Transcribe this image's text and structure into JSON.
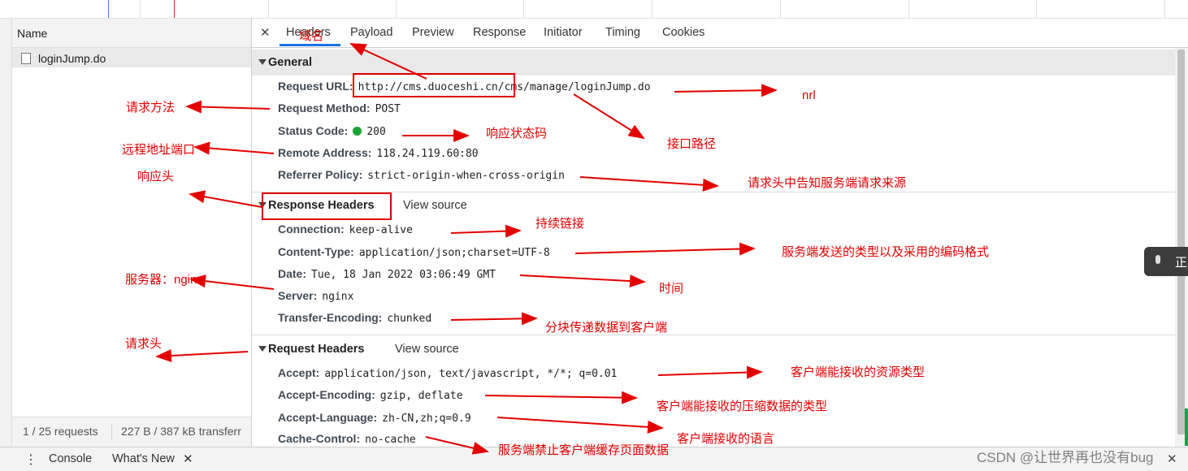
{
  "timeline": {},
  "name_panel": {
    "header": "Name",
    "file": "loginJump.do",
    "footer_requests": "1 / 25 requests",
    "footer_transfer": "227 B / 387 kB transferr"
  },
  "tabs": [
    "Headers",
    "Payload",
    "Preview",
    "Response",
    "Initiator",
    "Timing",
    "Cookies"
  ],
  "general": {
    "title": "General",
    "rows": [
      {
        "k": "Request URL:",
        "v": "http://cms.duoceshi.cn/cms/manage/loginJump.do"
      },
      {
        "k": "Request Method:",
        "v": "POST"
      },
      {
        "k": "Status Code:",
        "v": "200"
      },
      {
        "k": "Remote Address:",
        "v": "118.24.119.60:80"
      },
      {
        "k": "Referrer Policy:",
        "v": "strict-origin-when-cross-origin"
      }
    ]
  },
  "response_headers": {
    "title": "Response Headers",
    "view_source": "View source",
    "rows": [
      {
        "k": "Connection:",
        "v": "keep-alive"
      },
      {
        "k": "Content-Type:",
        "v": "application/json;charset=UTF-8"
      },
      {
        "k": "Date:",
        "v": "Tue, 18 Jan 2022 03:06:49 GMT"
      },
      {
        "k": "Server:",
        "v": "nginx"
      },
      {
        "k": "Transfer-Encoding:",
        "v": "chunked"
      }
    ]
  },
  "request_headers": {
    "title": "Request Headers",
    "view_source": "View source",
    "rows": [
      {
        "k": "Accept:",
        "v": "application/json, text/javascript, */*; q=0.01"
      },
      {
        "k": "Accept-Encoding:",
        "v": "gzip, deflate"
      },
      {
        "k": "Accept-Language:",
        "v": "zh-CN,zh;q=0.9"
      },
      {
        "k": "Cache-Control:",
        "v": "no-cache"
      }
    ]
  },
  "drawer": {
    "menu": "⋮",
    "console": "Console",
    "whats_new": "What's New",
    "close": "✕"
  },
  "voice_widget": {
    "text": "正"
  },
  "watermark": "CSDN @让世界再也没有bug",
  "annotations": {
    "domain": "域名",
    "url": "nrl",
    "path": "接口路径",
    "method": "请求方法",
    "status": "响应状态码",
    "remote": "远程地址端口",
    "referrer": "请求头中告知服务端请求来源",
    "resp_head": "响应头",
    "keepalive": "持续链接",
    "content_type": "服务端发送的类型以及采用的编码格式",
    "date": "时间",
    "server": "服务器：nginx",
    "chunked": "分块传递数据到客户端",
    "req_head": "请求头",
    "accept": "客户端能接收的资源类型",
    "encoding": "客户端能接收的压缩数据的类型",
    "language": "客户端接收的语言",
    "cache": "服务端禁止客户端缓存页面数据"
  },
  "colors": {
    "annotation": "#e30000",
    "tab_active_underline": "#1a73e8",
    "status_ok": "#19a330"
  }
}
